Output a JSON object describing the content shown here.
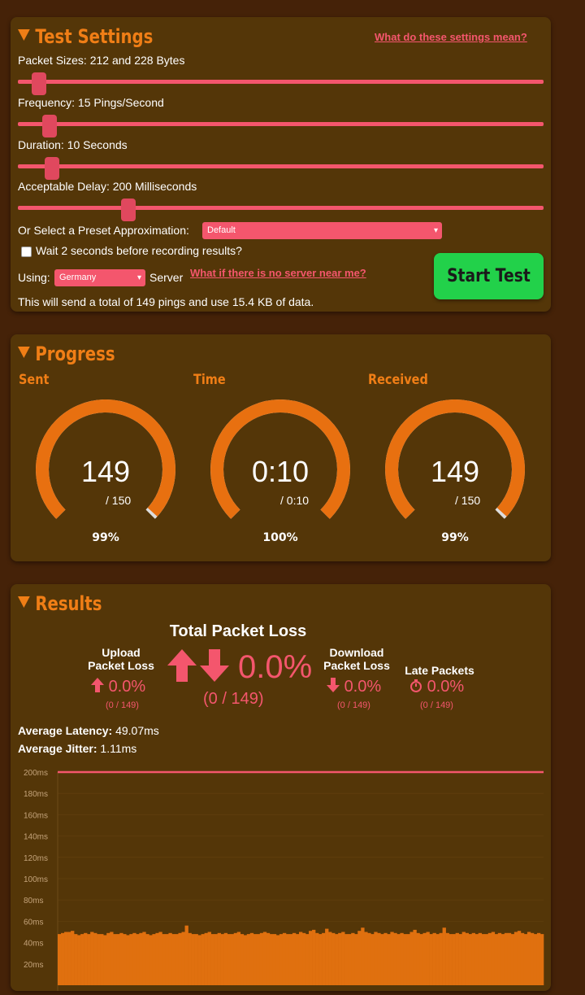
{
  "settings": {
    "title": "Test Settings",
    "help_link": "What do these settings mean?",
    "packet_sizes_label": "Packet Sizes: 212 and 228 Bytes",
    "frequency_label": "Frequency: 15 Pings/Second",
    "duration_label": "Duration: 10 Seconds",
    "delay_label": "Acceptable Delay: 200 Milliseconds",
    "preset_label": "Or Select a Preset Approximation:",
    "preset_value": "Default",
    "wait_label": "Wait 2 seconds before recording results?",
    "wait_checked": false,
    "using_label": "Using:",
    "server_value": "Germany",
    "server_label": "Server",
    "no_server_link": "What if there is no server near me?",
    "start_button": "Start Test",
    "summary": "This will send a total of 149 pings and use 15.4 KB of data.",
    "slider_levels": {
      "packet_sizes": 0.04,
      "frequency": 0.06,
      "duration": 0.065,
      "delay": 0.21
    },
    "colors": {
      "accent": "#f07e16",
      "slider": "#f4566d",
      "start": "#22d14a"
    }
  },
  "progress": {
    "title": "Progress",
    "gauges": [
      {
        "label": "Sent",
        "value": "149",
        "max": "/ 150",
        "percent": "99%",
        "fraction": 0.99
      },
      {
        "label": "Time",
        "value": "0:10",
        "max": "/ 0:10",
        "percent": "100%",
        "fraction": 1.0
      },
      {
        "label": "Received",
        "value": "149",
        "max": "/ 150",
        "percent": "99%",
        "fraction": 0.99
      }
    ]
  },
  "results": {
    "title": "Results",
    "total_title": "Total Packet Loss",
    "total_value": "0.0%",
    "total_sub": "(0 / 149)",
    "upload_title_1": "Upload",
    "upload_title_2": "Packet Loss",
    "upload_value": "0.0%",
    "upload_sub": "(0 / 149)",
    "download_title_1": "Download",
    "download_title_2": "Packet Loss",
    "download_value": "0.0%",
    "download_sub": "(0 / 149)",
    "late_title": "Late Packets",
    "late_value": "0.0%",
    "late_sub": "(0 / 149)",
    "avg_latency_label": "Average Latency:",
    "avg_latency_value": "49.07ms",
    "avg_jitter_label": "Average Jitter:",
    "avg_jitter_value": "1.11ms"
  },
  "chart_data": {
    "type": "bar",
    "yticks": [
      "200ms",
      "180ms",
      "160ms",
      "140ms",
      "120ms",
      "100ms",
      "80ms",
      "60ms",
      "40ms",
      "20ms"
    ],
    "ylim": [
      0,
      200
    ],
    "threshold": 200,
    "threshold_color": "#f4566d",
    "bar_color": "#e0700f",
    "count": 149,
    "values": [
      48,
      49,
      50,
      50,
      51,
      48,
      47,
      48,
      49,
      48,
      50,
      49,
      48,
      48,
      47,
      49,
      50,
      48,
      48,
      49,
      48,
      47,
      48,
      49,
      48,
      49,
      50,
      48,
      47,
      48,
      49,
      50,
      48,
      48,
      49,
      48,
      48,
      49,
      50,
      56,
      49,
      48,
      48,
      47,
      48,
      49,
      50,
      48,
      48,
      49,
      48,
      49,
      48,
      48,
      49,
      50,
      48,
      47,
      48,
      49,
      48,
      48,
      49,
      50,
      49,
      48,
      48,
      47,
      48,
      49,
      48,
      48,
      49,
      48,
      50,
      49,
      48,
      51,
      52,
      49,
      48,
      49,
      53,
      50,
      49,
      48,
      49,
      50,
      48,
      48,
      49,
      48,
      51,
      54,
      50,
      49,
      48,
      50,
      49,
      48,
      49,
      48,
      50,
      49,
      48,
      49,
      48,
      48,
      50,
      52,
      49,
      48,
      49,
      50,
      48,
      49,
      48,
      49,
      54,
      49,
      48,
      48,
      49,
      48,
      50,
      49,
      48,
      49,
      48,
      49,
      48,
      48,
      49,
      50,
      48,
      49,
      48,
      49,
      49,
      48,
      50,
      51,
      49,
      48,
      50,
      49,
      48,
      49,
      48
    ]
  }
}
